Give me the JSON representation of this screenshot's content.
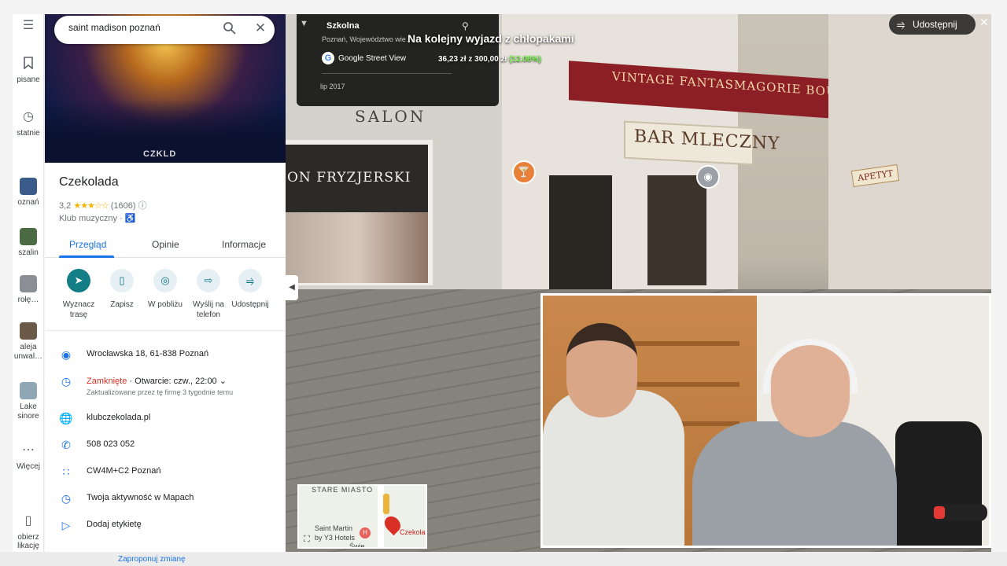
{
  "rail": {
    "items": [
      {
        "label": "pisane",
        "icon": "bookmark-icon"
      },
      {
        "label": "statnie",
        "icon": "history-icon"
      },
      {
        "label": "oznań",
        "icon": "thumb-poznan"
      },
      {
        "label": "szalin",
        "icon": "thumb-koszalin"
      },
      {
        "label": "rołę…",
        "icon": "thumb-place"
      },
      {
        "label": "aleja\nunwal…",
        "icon": "thumb-aleja"
      },
      {
        "label": "Lake\nsinore",
        "icon": "thumb-lake"
      },
      {
        "label": "Więcej",
        "icon": "more-icon"
      },
      {
        "label": "obierz\nlikację",
        "icon": "phone-icon"
      }
    ]
  },
  "search": {
    "value": "saint madison poznań"
  },
  "place": {
    "hero_logo": "CZKLD",
    "name": "Czekolada",
    "rating": "3,2",
    "stars": "★★★☆☆",
    "reviews": "(1606)",
    "category": "Klub muzyczny · "
  },
  "tabs": [
    {
      "label": "Przegląd",
      "active": true
    },
    {
      "label": "Opinie",
      "active": false
    },
    {
      "label": "Informacje",
      "active": false
    }
  ],
  "actions": [
    {
      "label": "Wyznacz trasę",
      "icon": "directions-icon"
    },
    {
      "label": "Zapisz",
      "icon": "bookmark-icon"
    },
    {
      "label": "W pobliżu",
      "icon": "nearby-icon"
    },
    {
      "label": "Wyślij na telefon",
      "icon": "send-phone-icon"
    },
    {
      "label": "Udostępnij",
      "icon": "share-icon"
    }
  ],
  "info": {
    "address": "Wrocławska 18, 61-838 Poznań",
    "hours_status": "Zamknięte",
    "hours_next": " · Otwarcie: czw., 22:00",
    "hours_note": "Zaktualizowane przez tę firmę 3 tygodnie temu",
    "website": "klubczekolada.pl",
    "phone": "508 023 052",
    "plus_code": "CW4M+C2 Poznań",
    "activity": "Twoja aktywność w Mapach",
    "label_action": "Dodaj etykietę"
  },
  "street_view": {
    "street": "Szkolna",
    "region": "Poznań, Województwo wie…",
    "brand": "Google Street View",
    "date": "lip 2017",
    "share_label": "Udostępnij",
    "signs": {
      "salon": "SALON",
      "fryzjerski": "ON FRYZJERSKI",
      "fantasmagorie": "VINTAGE FANTASMAGORIE BOUTIQUE",
      "bar": "BAR MLECZNY",
      "apetyt": "APETYT"
    }
  },
  "stream_overlay": {
    "title": "Na kolejny wyjazd z chłopakami",
    "amount": "36,23 zł",
    "of": " z ",
    "goal": "300,00 zł",
    "percent": "(12.08%)"
  },
  "minimap": {
    "district": "STARE MIASTO",
    "hotel": "Saint Martin\nby Y3 Hotels",
    "pin_label": "Czekola",
    "street_fragment": "Świę…"
  },
  "bottom": {
    "suggest": "Zaproponuj zmianę"
  }
}
